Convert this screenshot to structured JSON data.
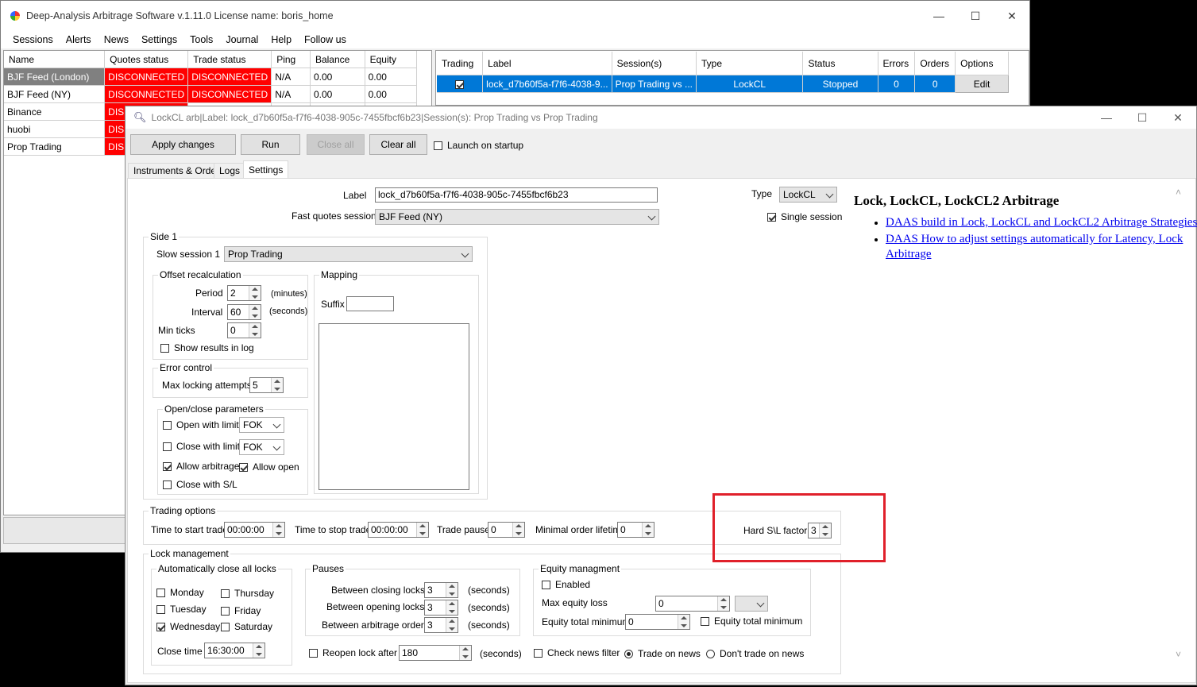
{
  "main": {
    "title": "Deep-Analysis Arbitrage Software v.1.11.0 License name: boris_home",
    "menu": [
      "Sessions",
      "Alerts",
      "News",
      "Settings",
      "Tools",
      "Journal",
      "Help",
      "Follow us"
    ],
    "sessions_grid": {
      "headers": [
        "Name",
        "Quotes status",
        "Trade status",
        "Ping",
        "Balance",
        "Equity"
      ],
      "rows": [
        {
          "name": "BJF Feed (London)",
          "quotes": "DISCONNECTED",
          "trade": "DISCONNECTED",
          "ping": "N/A",
          "balance": "0.00",
          "equity": "0.00"
        },
        {
          "name": "BJF Feed (NY)",
          "quotes": "DISCONNECTED",
          "trade": "DISCONNECTED",
          "ping": "N/A",
          "balance": "0.00",
          "equity": "0.00"
        },
        {
          "name": "Binance",
          "quotes": "DIS"
        },
        {
          "name": "huobi",
          "quotes": "DIS"
        },
        {
          "name": "Prop Trading",
          "quotes": "DIS"
        }
      ]
    },
    "strategies_grid": {
      "headers": [
        "Trading",
        "Label",
        "Session(s)",
        "Type",
        "Status",
        "Errors",
        "Orders",
        "Options"
      ],
      "row": {
        "label": "lock_d7b60f5a-f7f6-4038-9...",
        "sessions": "Prop Trading vs ...",
        "type": "LockCL",
        "status": "Stopped",
        "errors": "0",
        "orders": "0",
        "option": "Edit"
      }
    }
  },
  "dialog": {
    "title": "LockCL arb|Label: lock_d7b60f5a-f7f6-4038-905c-7455fbcf6b23|Session(s): Prop Trading vs Prop Trading",
    "toolbar": {
      "apply": "Apply changes",
      "run": "Run",
      "close_all": "Close all",
      "clear_all": "Clear all",
      "launch": "Launch on startup"
    },
    "tabs": [
      "Instruments & Orders",
      "Logs",
      "Settings"
    ],
    "settings": {
      "label_caption": "Label",
      "label_value": "lock_d7b60f5a-f7f6-4038-905c-7455fbcf6b23",
      "fast_caption": "Fast quotes session",
      "fast_value": "BJF Feed (NY)",
      "type_caption": "Type",
      "type_value": "LockCL",
      "single_session": "Single session",
      "side1": "Side 1",
      "slow_caption": "Slow session 1",
      "slow_value": "Prop Trading",
      "offset": "Offset recalculation",
      "period": "Period",
      "period_value": "2",
      "minutes": "(minutes)",
      "interval": "Interval",
      "interval_value": "60",
      "seconds": "(seconds)",
      "min_ticks": "Min ticks",
      "min_ticks_value": "0",
      "show_results": "Show results in log",
      "mapping": "Mapping",
      "suffix": "Suffix",
      "error_control": "Error control",
      "max_locking": "Max locking attempts",
      "max_locking_value": "5",
      "open_close": "Open/close parameters",
      "open_limit": "Open with limit",
      "open_limit_value": "FOK",
      "close_limit": "Close with limit",
      "close_limit_value": "FOK",
      "allow_arb": "Allow arbitrage",
      "allow_open": "Allow open",
      "close_sl": "Close with S/L",
      "trading_options": "Trading options",
      "time_start": "Time to start trade",
      "time_start_value": "00:00:00",
      "time_stop": "Time to stop trade",
      "time_stop_value": "00:00:00",
      "trade_pause": "Trade pause",
      "trade_pause_value": "0",
      "min_order": "Minimal order lifetime",
      "min_order_value": "0",
      "hard_sl": "Hard S\\L factor",
      "hard_sl_value": "3",
      "lock_mgmt": "Lock management",
      "auto_close": "Automatically close all locks",
      "days": [
        "Monday",
        "Thursday",
        "Tuesday",
        "Friday",
        "Wednesday",
        "Saturday"
      ],
      "close_time": "Close time",
      "close_time_value": "16:30:00",
      "pauses": "Pauses",
      "between_closing": "Between closing locks",
      "between_closing_value": "3",
      "between_opening": "Between opening locks",
      "between_opening_value": "3",
      "between_arb": "Between arbitrage orders",
      "between_arb_value": "3",
      "equity": "Equity managment",
      "enabled": "Enabled",
      "max_equity": "Max equity loss",
      "max_equity_value": "0",
      "equity_min": "Equity total minimum",
      "equity_min_value": "0",
      "equity_min_cb": "Equity total minimum",
      "reopen": "Reopen lock after",
      "reopen_value": "180",
      "check_news": "Check news filter",
      "trade_news": "Trade on news",
      "dont_trade_news": "Don't trade on news"
    },
    "help": {
      "title": "Lock, LockCL, LockCL2 Arbitrage",
      "links": [
        "DAAS build in Lock, LockCL and LockCL2 Arbitrage Strategies",
        "DAAS How to adjust settings automatically for Latency, Lock Arbitrage"
      ]
    }
  },
  "colors": {
    "disconnected": "#ff0000",
    "selection": "#0078d7",
    "highlight_box": "#e0202a"
  }
}
